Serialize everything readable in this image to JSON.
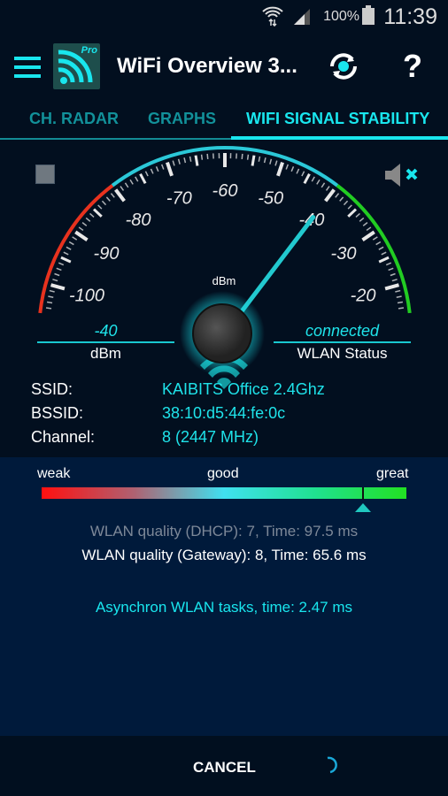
{
  "status_bar": {
    "battery": "100%",
    "time": "11:39",
    "icons": [
      "wifi-icon",
      "signal-icon",
      "battery-icon"
    ]
  },
  "app_bar": {
    "title": "WiFi Overview 3...",
    "logo_badge": "Pro",
    "icons": [
      "menu-icon",
      "refresh-icon",
      "help-icon"
    ],
    "help_glyph": "?"
  },
  "tabs": [
    {
      "label": "CH. RADAR",
      "active": false
    },
    {
      "label": "GRAPHS",
      "active": false
    },
    {
      "label": "WIFI SIGNAL STABILITY",
      "active": true
    }
  ],
  "gauge": {
    "value": -40,
    "unit": "dBm",
    "tick_labels": [
      "-100",
      "-90",
      "-80",
      "-70",
      "-60",
      "-50",
      "-40",
      "-30",
      "-20"
    ],
    "zones": [
      {
        "color": "#e8321e",
        "to": -80
      },
      {
        "color": "#2bc8d8",
        "to": -40
      },
      {
        "color": "#22cc22",
        "to": -15
      }
    ],
    "needle_color": "#22c9cf"
  },
  "readouts": {
    "value": "-40",
    "value_label": "dBm",
    "status": "connected",
    "status_label": "WLAN Status"
  },
  "info": [
    {
      "label": "SSID:",
      "value": "KAIBITS Office 2.4Ghz"
    },
    {
      "label": "BSSID:",
      "value": "38:10:d5:44:fe:0c"
    },
    {
      "label": "Channel:",
      "value": "8 (2447 MHz)"
    }
  ],
  "quality": {
    "labels": {
      "weak": "weak",
      "good": "good",
      "great": "great"
    },
    "level_fraction": 0.88
  },
  "stats": {
    "dhcp": "WLAN quality (DHCP): 7, Time: 97.5 ms",
    "gateway": "WLAN quality (Gateway): 8, Time: 65.6 ms",
    "async": "Asynchron WLAN tasks, time: 2.47 ms"
  },
  "footer": {
    "cancel": "CANCEL"
  },
  "colors": {
    "accent": "#19e6ee",
    "background": "#020f1f",
    "panel": "#001a3b"
  }
}
